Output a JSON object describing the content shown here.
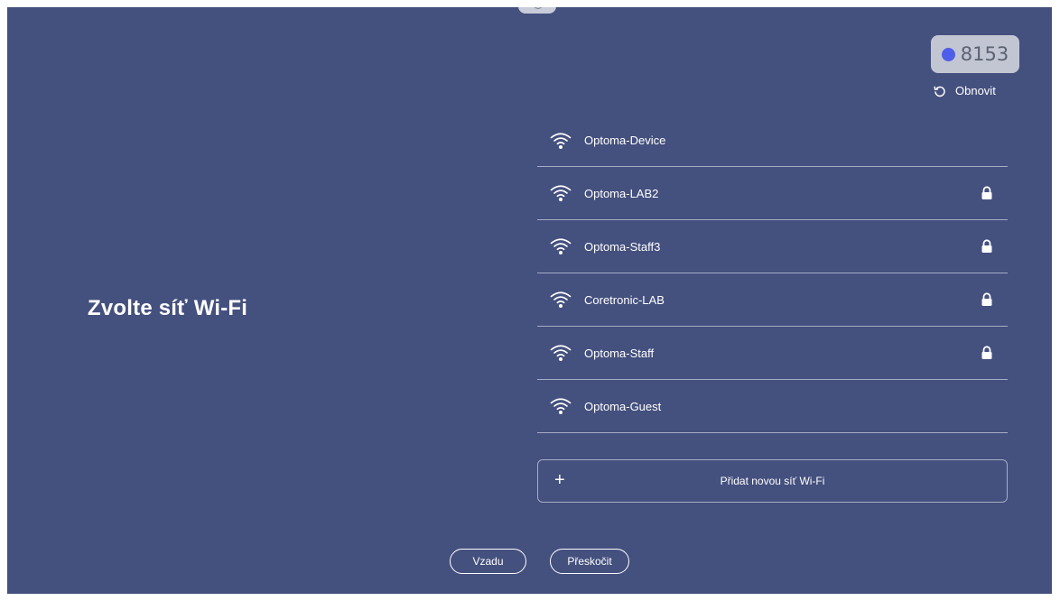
{
  "page": {
    "title": "Zvolte síť Wi-Fi"
  },
  "code_badge": {
    "code": "8153",
    "dot_color": "#4f5ee8"
  },
  "refresh": {
    "label": "Obnovit",
    "icon": "refresh-icon"
  },
  "networks": [
    {
      "ssid": "Optoma-Device",
      "secured": false
    },
    {
      "ssid": "Optoma-LAB2",
      "secured": true
    },
    {
      "ssid": "Optoma-Staff3",
      "secured": true
    },
    {
      "ssid": "Coretronic-LAB",
      "secured": true
    },
    {
      "ssid": "Optoma-Staff",
      "secured": true
    },
    {
      "ssid": "Optoma-Guest",
      "secured": false
    }
  ],
  "add_network": {
    "icon": "+",
    "label": "Přidat novou síť Wi-Fi"
  },
  "footer": {
    "back_label": "Vzadu",
    "skip_label": "Přeskočit"
  },
  "colors": {
    "background": "#44507e",
    "badge_background": "#c2c6d3",
    "divider": "#a5acc6"
  }
}
